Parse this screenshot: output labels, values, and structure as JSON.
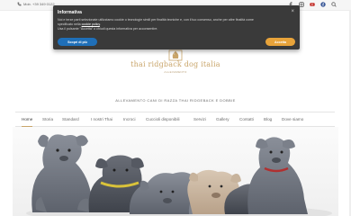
{
  "topbar": {
    "phone": "Mob. +39 349 0122",
    "social_icons": [
      "facebook-icon",
      "instagram-icon",
      "youtube-icon",
      "facebook-icon",
      "search-icon"
    ]
  },
  "cookie": {
    "title": "Informativa",
    "close": "×",
    "text_line1": "Noi e terze parti selezionate utilizziamo cookie o tecnologie simili per finalità tecniche e, con il tuo consenso, anche per altre finalità come",
    "text_line2a": "specificato nella",
    "link": "cookie policy",
    "text_line2b": ".",
    "text_line3": "Usa il pulsante \"Accetta\" o chiudi questa informativa per acconsentire.",
    "more_button": "Scopri di più",
    "accept_button": "Accetta",
    "accept_color": "#e8a33a",
    "more_color": "#1f6fb8"
  },
  "logo": {
    "title": "thai ridgback dog italia",
    "subtitle": "ALLEVAMENTO"
  },
  "tagline": "ALLEVAMENTO CANI DI RAZZA THAI RIDGEBACK E DOBBIE",
  "nav": {
    "items": [
      "Home",
      "Storia",
      "Standard",
      "I nostri Thai",
      "Incroci",
      "Cuccioli disponibili",
      "Servizi",
      "Gallery",
      "Contatti",
      "Blog",
      "Dove siamo"
    ],
    "active": "Home",
    "accent_color": "#c9a56a"
  }
}
